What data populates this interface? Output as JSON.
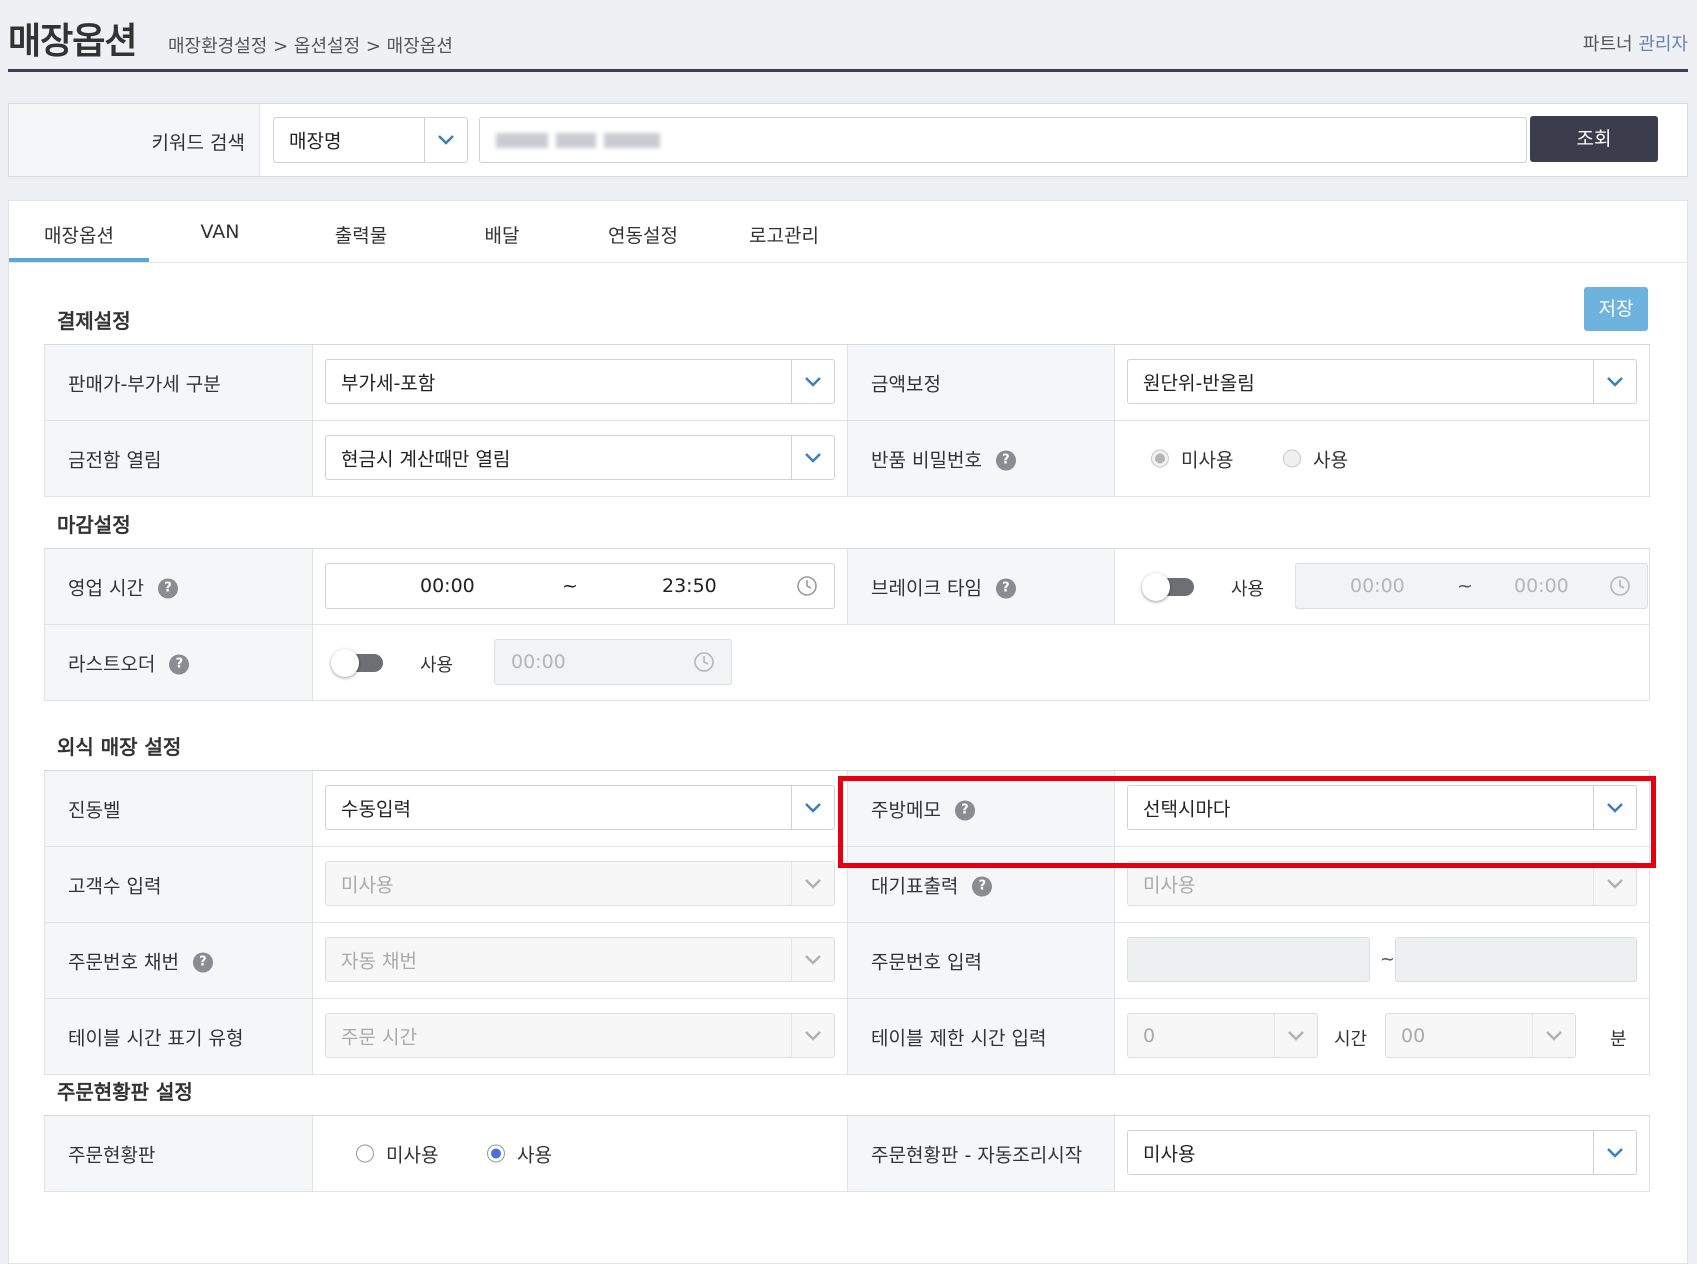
{
  "header": {
    "title": "매장옵션",
    "breadcrumb": "매장환경설정 > 옵션설정 > 매장옵션",
    "admin_prefix": "파트너",
    "admin_highlight": "관리자"
  },
  "search": {
    "label": "키워드 검색",
    "type_value": "매장명",
    "button": "조회"
  },
  "tabs": [
    "매장옵션",
    "VAN",
    "출력물",
    "배달",
    "연동설정",
    "로고관리"
  ],
  "save_button": "저장",
  "payment": {
    "title": "결제설정",
    "vat_label": "판매가-부가세 구분",
    "vat_value": "부가세-포함",
    "rounding_label": "금액보정",
    "rounding_value": "원단위-반올림",
    "drawer_label": "금전함 열림",
    "drawer_value": "현금시 계산때만 열림",
    "refund_pw_label": "반품 비밀번호",
    "refund_pw_opt1": "미사용",
    "refund_pw_opt2": "사용"
  },
  "closing": {
    "title": "마감설정",
    "hours_label": "영업 시간",
    "hours_start": "00:00",
    "hours_sep": "~",
    "hours_end": "23:50",
    "break_label": "브레이크 타임",
    "break_use": "사용",
    "break_start": "00:00",
    "break_end": "00:00",
    "lastorder_label": "라스트오더",
    "lastorder_use": "사용",
    "lastorder_time": "00:00"
  },
  "dine": {
    "title": "외식 매장 설정",
    "pager_label": "진동벨",
    "pager_value": "수동입력",
    "kitchen_memo_label": "주방메모",
    "kitchen_memo_value": "선택시마다",
    "guest_label": "고객수 입력",
    "guest_value": "미사용",
    "waiting_label": "대기표출력",
    "waiting_value": "미사용",
    "order_no_label": "주문번호 채번",
    "order_no_value": "자동 채번",
    "order_no_input_label": "주문번호 입력",
    "order_no_sep": "~",
    "table_time_type_label": "테이블 시간 표기 유형",
    "table_time_type_value": "주문 시간",
    "table_limit_label": "테이블 제한 시간 입력",
    "table_limit_hours": "0",
    "table_limit_hours_unit": "시간",
    "table_limit_minutes": "00",
    "table_limit_minutes_unit": "분"
  },
  "board": {
    "title": "주문현황판 설정",
    "board_label": "주문현황판",
    "board_opt1": "미사용",
    "board_opt2": "사용",
    "auto_cook_label": "주문현황판 - 자동조리시작",
    "auto_cook_value": "미사용"
  },
  "colors": {
    "accent": "#5aa8d8",
    "dark_button": "#3b3d4c",
    "save_button": "#6eb3dd",
    "highlight": "#e6000f"
  }
}
